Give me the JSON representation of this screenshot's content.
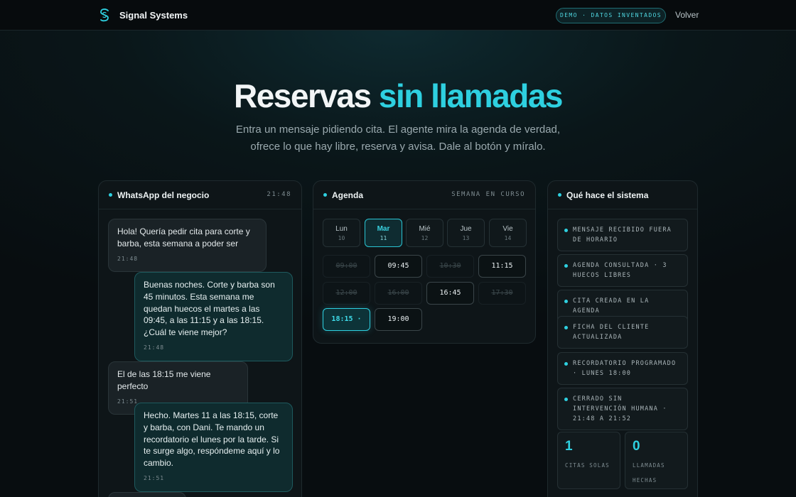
{
  "header": {
    "brand": "Signal Systems",
    "badge": "DEMO · DATOS INVENTADOS",
    "back": "Volver"
  },
  "hero": {
    "title_main": "Reservas",
    "title_accent": "sin llamadas",
    "subtitle_line1": "Entra un mensaje pidiendo cita. El agente mira la agenda de verdad,",
    "subtitle_line2": "ofrece lo que hay libre, reserva y avisa. Dale al botón y míralo."
  },
  "chat": {
    "title": "WhatsApp del negocio",
    "clock": "21:48",
    "messages": [
      {
        "dir": "in",
        "text": "Hola! Quería pedir cita para corte y barba, esta semana a poder ser",
        "time": "21:48"
      },
      {
        "dir": "out",
        "text": "Buenas noches. Corte y barba son 45 minutos. Esta semana me quedan huecos el martes a las 09:45, a las 11:15 y a las 18:15. ¿Cuál te viene mejor?",
        "time": "21:48"
      },
      {
        "dir": "in",
        "text": "El de las 18:15 me viene perfecto",
        "time": "21:51"
      },
      {
        "dir": "out",
        "text": "Hecho. Martes 11 a las 18:15, corte y barba, con Dani. Te mando un recordatorio el lunes por la tarde. Si te surge algo, respóndeme aquí y lo cambio.",
        "time": "21:51"
      }
    ]
  },
  "agenda": {
    "title": "Agenda",
    "range": "SEMANA EN CURSO",
    "days": [
      {
        "name": "Lun",
        "num": "10"
      },
      {
        "name": "Mar",
        "num": "11"
      },
      {
        "name": "Mié",
        "num": "12"
      },
      {
        "name": "Jue",
        "num": "13"
      },
      {
        "name": "Vie",
        "num": "14"
      }
    ],
    "selected_day": 1,
    "slots": [
      {
        "time": "09:00",
        "state": "taken"
      },
      {
        "time": "09:45",
        "state": "free"
      },
      {
        "time": "10:30",
        "state": "taken"
      },
      {
        "time": "11:15",
        "state": "free"
      },
      {
        "time": "12:00",
        "state": "taken"
      },
      {
        "time": "16:00",
        "state": "taken"
      },
      {
        "time": "16:45",
        "state": "free"
      },
      {
        "time": "17:30",
        "state": "taken"
      },
      {
        "time": "18:15 ·",
        "state": "chosen"
      },
      {
        "time": "19:00",
        "state": "free"
      }
    ]
  },
  "system": {
    "title": "Qué hace el sistema",
    "steps": [
      "MENSAJE RECIBIDO FUERA DE HORARIO",
      "AGENDA CONSULTADA · 3 HUECOS LIBRES",
      "CITA CREADA EN LA AGENDA",
      "FICHA DEL CLIENTE ACTUALIZADA",
      "RECORDATORIO PROGRAMADO · LUNES 18:00",
      "CERRADO SIN INTERVENCIÓN HUMANA · 21:48 A 21:52"
    ],
    "stats": [
      {
        "value": "1",
        "label": "CITAS SOLAS"
      },
      {
        "value": "0",
        "label": "LLAMADAS HECHAS"
      }
    ]
  },
  "colors": {
    "accent": "#2ed0e0",
    "background": "#080d10",
    "panel": "#0e1518"
  }
}
